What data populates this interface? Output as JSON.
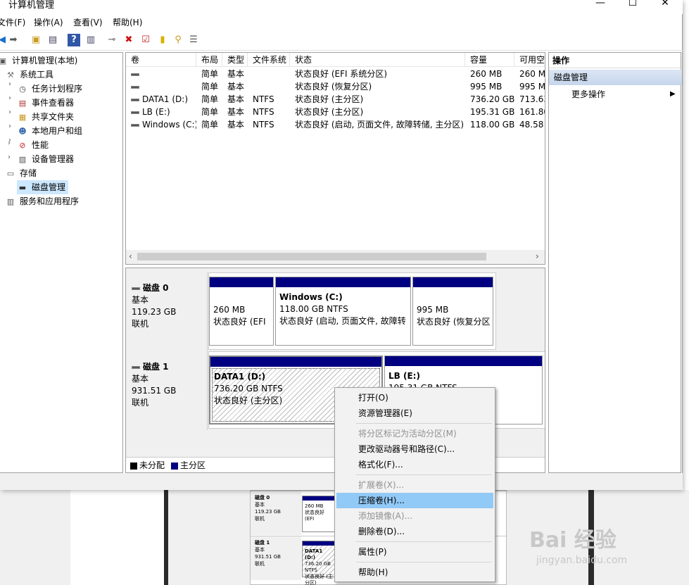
{
  "window": {
    "title": "计算机管理",
    "minimize": "—",
    "maximize": "☐",
    "close": "✕"
  },
  "menu": [
    "文件(F)",
    "操作(A)",
    "查看(V)",
    "帮助(H)"
  ],
  "tree": {
    "root": "计算机管理(本地)",
    "system_tools": "系统工具",
    "task_scheduler": "任务计划程序",
    "event_viewer": "事件查看器",
    "shared_folders": "共享文件夹",
    "local_users": "本地用户和组",
    "performance": "性能",
    "device_manager": "设备管理器",
    "storage": "存储",
    "disk_management": "磁盘管理",
    "services": "服务和应用程序"
  },
  "volume_table": {
    "columns": [
      "卷",
      "布局",
      "类型",
      "文件系统",
      "状态",
      "容量",
      "可用空"
    ],
    "rows": [
      {
        "volume": "",
        "layout": "简单",
        "type": "基本",
        "fs": "",
        "status": "状态良好 (EFI 系统分区)",
        "capacity": "260 MB",
        "free": "260 M"
      },
      {
        "volume": "",
        "layout": "简单",
        "type": "基本",
        "fs": "",
        "status": "状态良好 (恢复分区)",
        "capacity": "995 MB",
        "free": "995 M"
      },
      {
        "volume": "DATA1 (D:)",
        "layout": "简单",
        "type": "基本",
        "fs": "NTFS",
        "status": "状态良好 (主分区)",
        "capacity": "736.20 GB",
        "free": "713.63"
      },
      {
        "volume": "LB (E:)",
        "layout": "简单",
        "type": "基本",
        "fs": "NTFS",
        "status": "状态良好 (主分区)",
        "capacity": "195.31 GB",
        "free": "161.80"
      },
      {
        "volume": "Windows (C:)",
        "layout": "简单",
        "type": "基本",
        "fs": "NTFS",
        "status": "状态良好 (启动, 页面文件, 故障转储, 主分区)",
        "capacity": "118.00 GB",
        "free": "48.58"
      }
    ]
  },
  "disks": [
    {
      "name": "磁盘 0",
      "type": "基本",
      "size": "119.23 GB",
      "state": "联机",
      "partitions": [
        {
          "title": "",
          "line1": "260 MB",
          "line2": "状态良好 (EFI"
        },
        {
          "title": "Windows  (C:)",
          "line1": "118.00 GB NTFS",
          "line2": "状态良好 (启动, 页面文件, 故障转"
        },
        {
          "title": "",
          "line1": "995 MB",
          "line2": "状态良好 (恢复分区"
        }
      ]
    },
    {
      "name": "磁盘 1",
      "type": "基本",
      "size": "931.51 GB",
      "state": "联机",
      "partitions": [
        {
          "title": "DATA1  (D:)",
          "line1": "736.20 GB NTFS",
          "line2": "状态良好 (主分区)"
        },
        {
          "title": "LB  (E:)",
          "line1": "195.31 GB NTFS",
          "line2": ""
        }
      ]
    }
  ],
  "legend": {
    "unallocated": "未分配",
    "primary": "主分区"
  },
  "actions": {
    "header": "操作",
    "section": "磁盘管理",
    "more": "更多操作"
  },
  "context_menu": [
    {
      "label": "打开(O)",
      "enabled": true
    },
    {
      "label": "资源管理器(E)",
      "enabled": true
    },
    {
      "label": "将分区标记为活动分区(M)",
      "enabled": false
    },
    {
      "label": "更改驱动器号和路径(C)...",
      "enabled": true
    },
    {
      "label": "格式化(F)...",
      "enabled": true
    },
    {
      "label": "扩展卷(X)...",
      "enabled": false
    },
    {
      "label": "压缩卷(H)...",
      "enabled": true,
      "highlighted": true
    },
    {
      "label": "添加镜像(A)...",
      "enabled": false
    },
    {
      "label": "删除卷(D)...",
      "enabled": true
    },
    {
      "label": "属性(P)",
      "enabled": true
    },
    {
      "label": "帮助(H)",
      "enabled": true
    }
  ],
  "background_thumb": {
    "disk0": {
      "name": "磁盘 0",
      "type": "基本",
      "size": "119.23 GB",
      "state": "联机",
      "part_size": "260 MB",
      "part_status": "状态良好 (EFI"
    },
    "disk1": {
      "name": "磁盘 1",
      "type": "基本",
      "size": "931.51 GB",
      "state": "联机",
      "part_title": "DATA1 (D:)",
      "part_size": "736.20 GB NTFS",
      "part_status": "状态良好 (主分区)"
    }
  },
  "watermark": {
    "line1": "Bai 经验",
    "line2": "jingyan.baidu.com"
  },
  "colors": {
    "primary_partition": "#000080",
    "selection": "#cce8ff",
    "menu_highlight": "#91c9f7"
  }
}
